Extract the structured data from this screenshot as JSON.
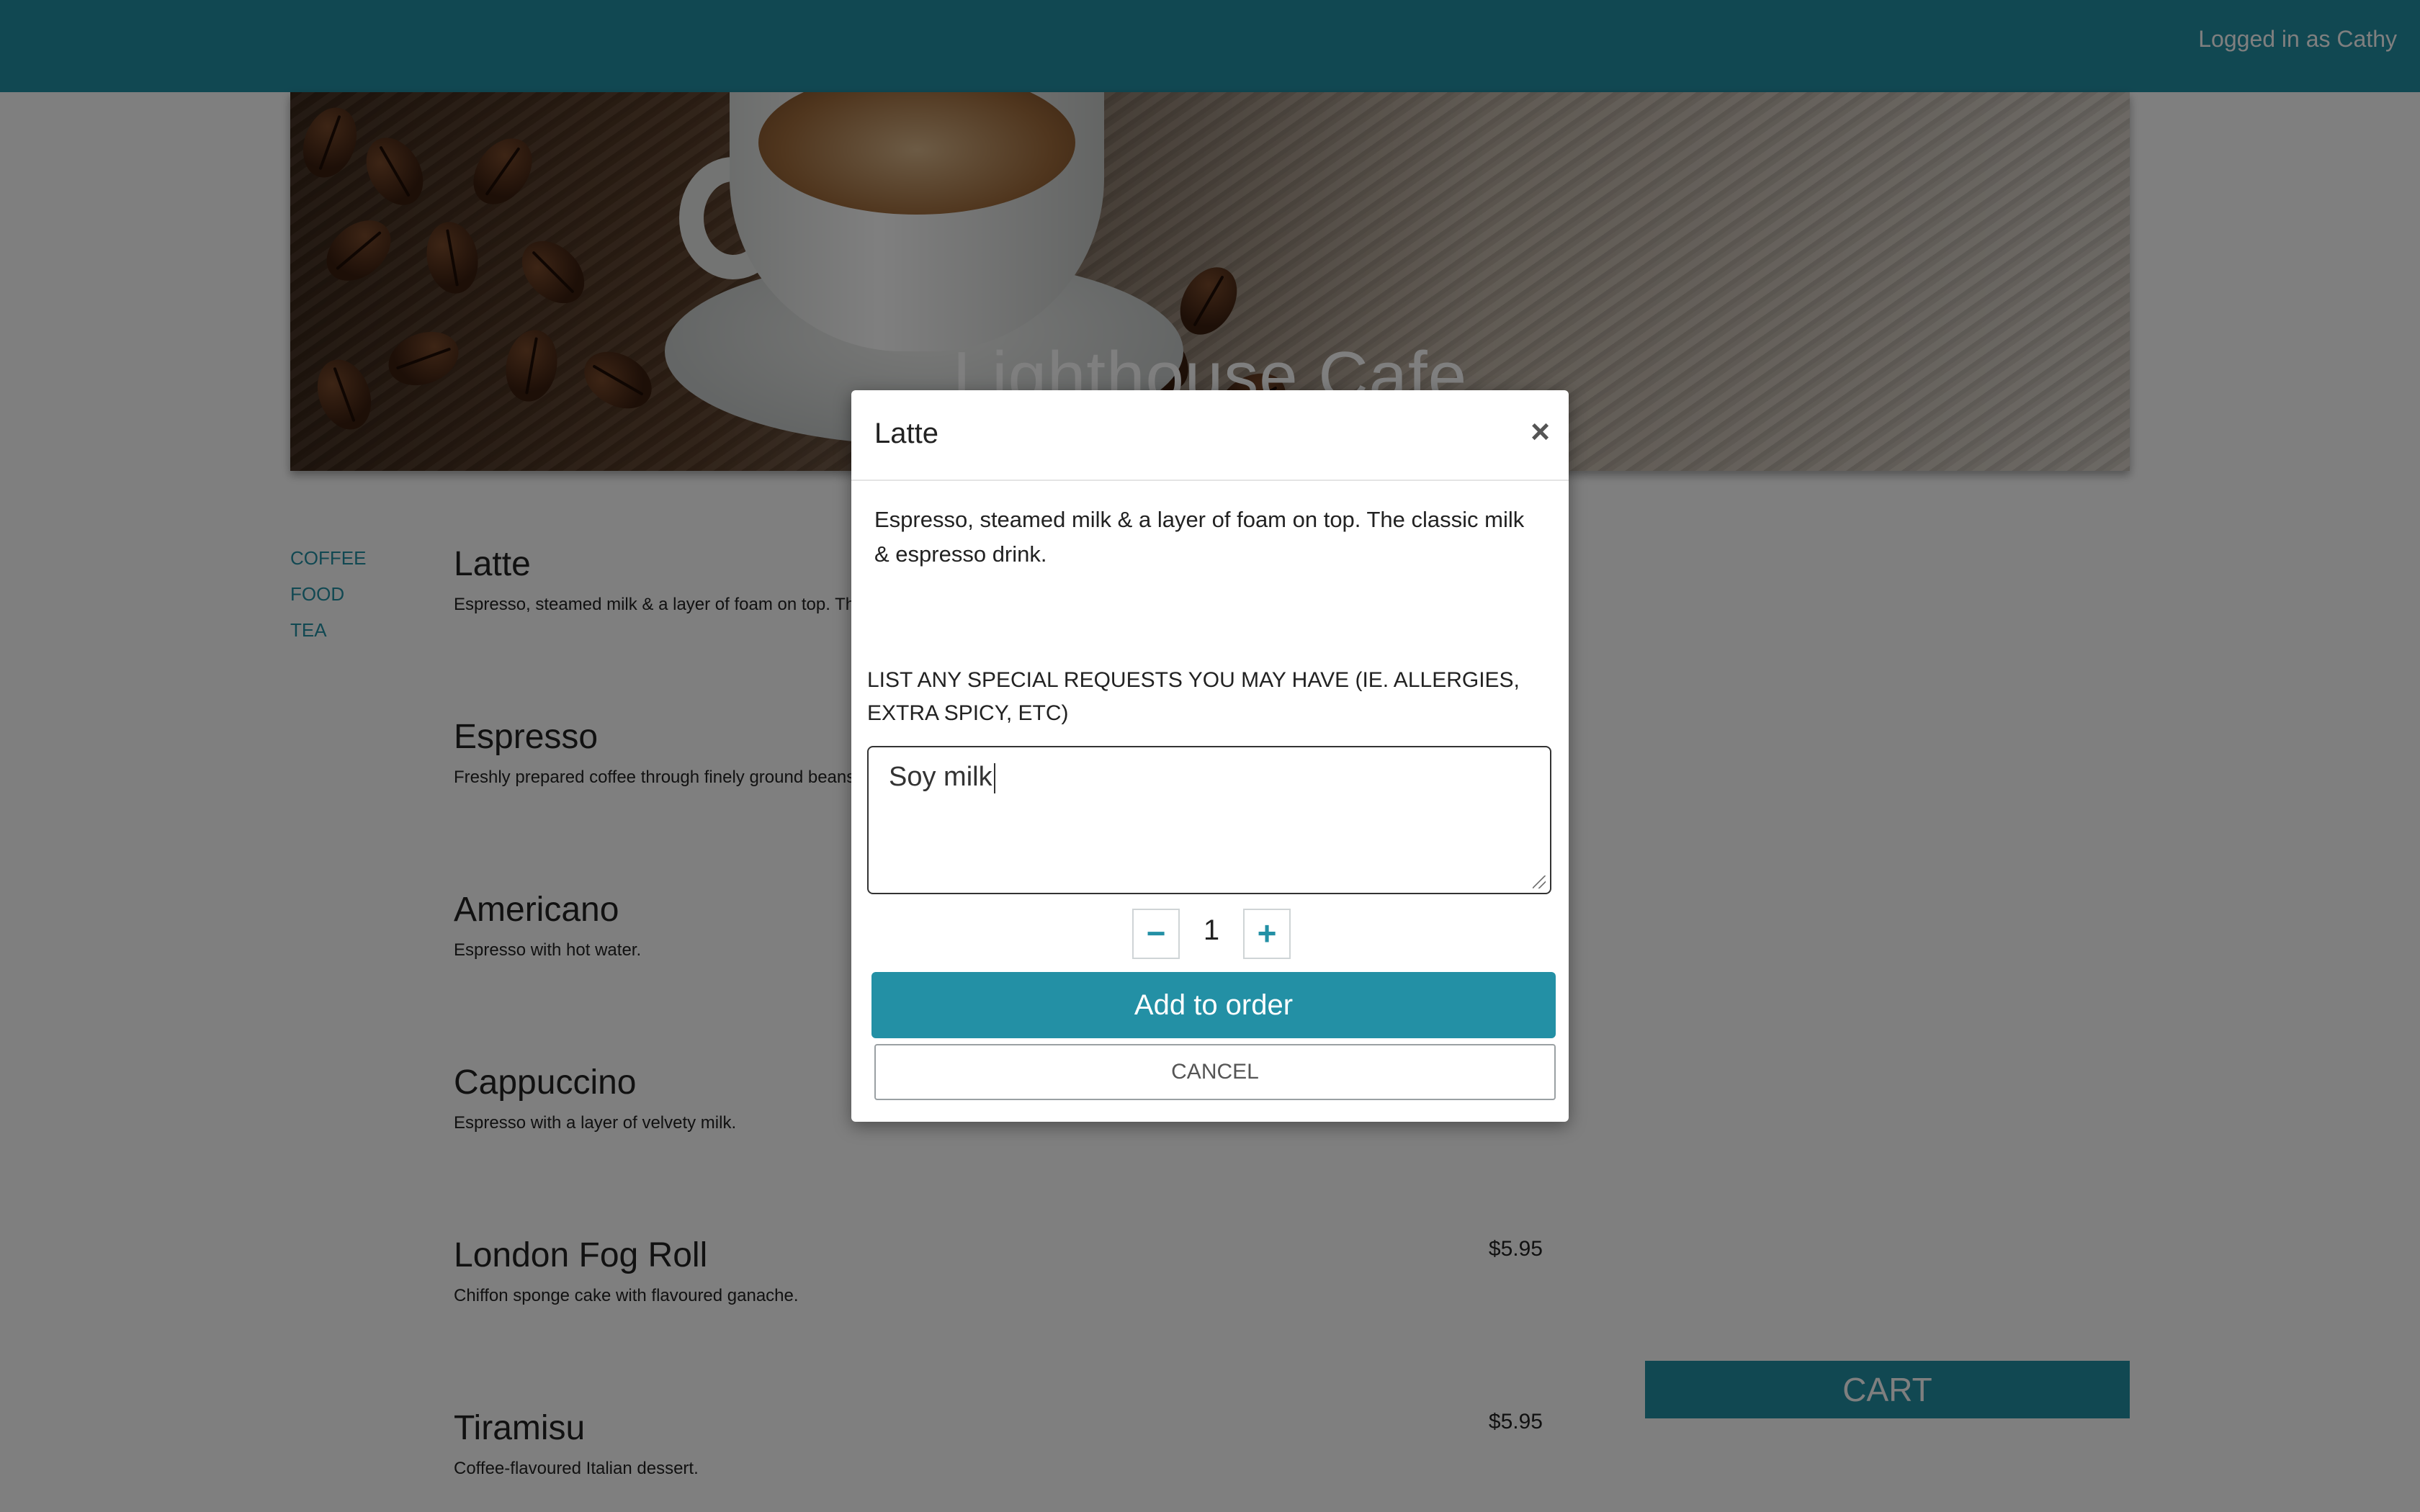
{
  "header": {
    "user_status": "Logged in as Cathy"
  },
  "hero": {
    "title": "Lighthouse Cafe"
  },
  "sidenav": {
    "items": [
      {
        "label": "COFFEE"
      },
      {
        "label": "FOOD"
      },
      {
        "label": "TEA"
      }
    ]
  },
  "menu": {
    "items": [
      {
        "name": "Latte",
        "desc": "Espresso, steamed milk & a layer of foam on top. The",
        "price": ""
      },
      {
        "name": "Espresso",
        "desc": "Freshly prepared coffee through finely ground beans",
        "price": ""
      },
      {
        "name": "Americano",
        "desc": "Espresso with hot water.",
        "price": ""
      },
      {
        "name": "Cappuccino",
        "desc": "Espresso with a layer of velvety milk.",
        "price": ""
      },
      {
        "name": "London Fog Roll",
        "desc": "Chiffon sponge cake with flavoured ganache.",
        "price": "$5.95"
      },
      {
        "name": "Tiramisu",
        "desc": "Coffee-flavoured Italian dessert.",
        "price": "$5.95"
      }
    ]
  },
  "cart": {
    "label": "CART"
  },
  "modal": {
    "title": "Latte",
    "close_icon": "×",
    "description": "Espresso, steamed milk & a layer of foam on top. The classic milk & espresso drink.",
    "requests_label": "LIST ANY SPECIAL REQUESTS YOU MAY HAVE (IE. ALLERGIES, EXTRA SPICY, ETC)",
    "requests_value": "Soy milk",
    "quantity": "1",
    "minus_icon": "−",
    "plus_icon": "+",
    "add_label": "Add to order",
    "cancel_label": "CANCEL"
  },
  "colors": {
    "accent": "#2390a5"
  }
}
